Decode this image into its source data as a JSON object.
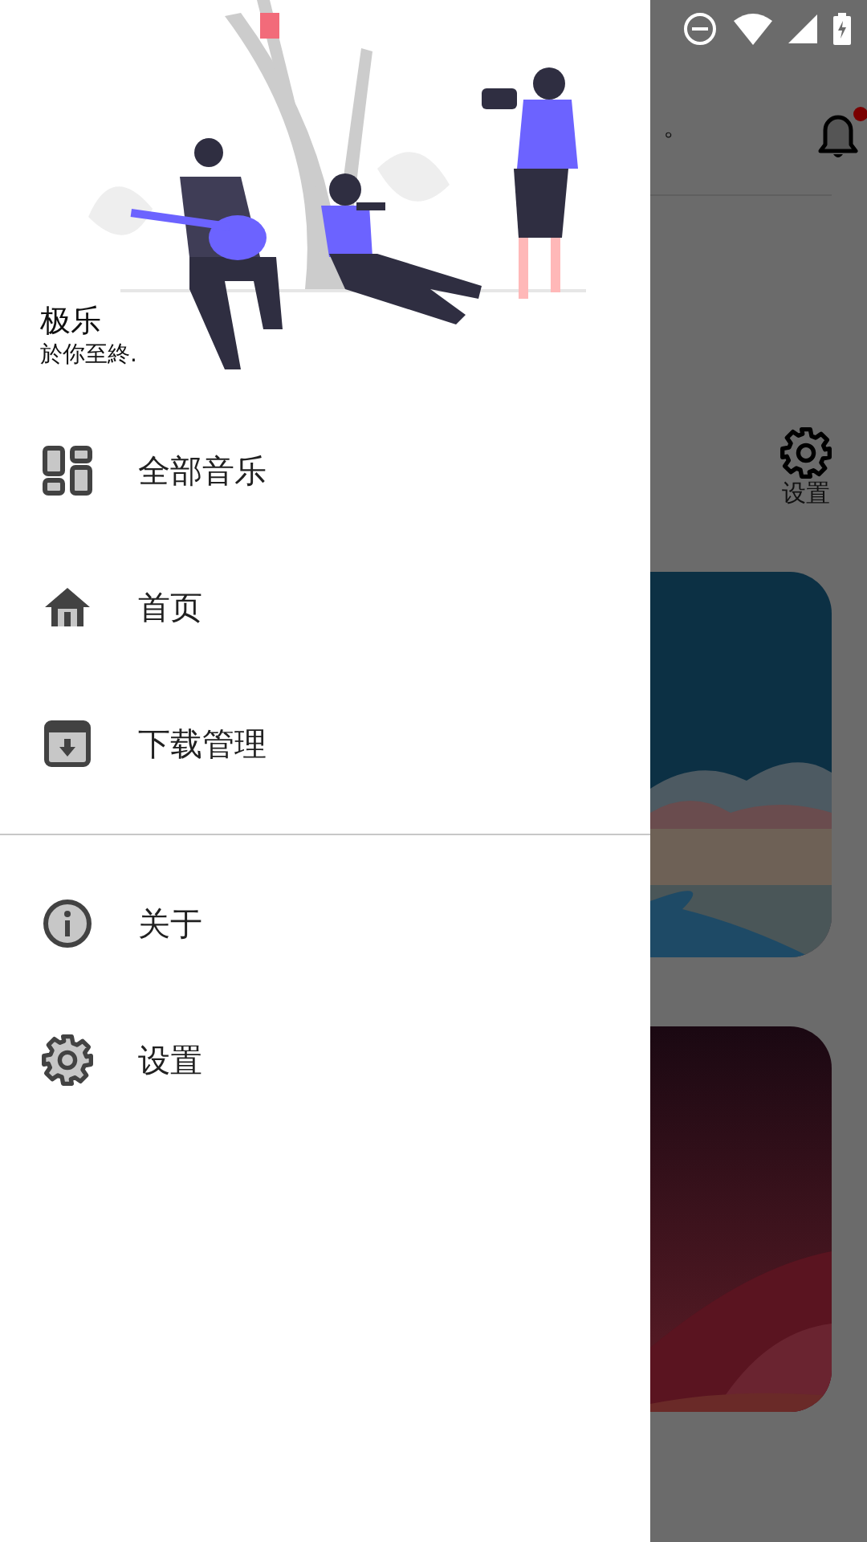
{
  "background": {
    "header_fragment": "。",
    "settings_label": "设置"
  },
  "drawer": {
    "title": "极乐",
    "subtitle": "於你至終.",
    "menu_groups": [
      [
        {
          "label": "全部音乐"
        },
        {
          "label": "首页"
        },
        {
          "label": "下载管理"
        }
      ],
      [
        {
          "label": "关于"
        },
        {
          "label": "设置"
        }
      ]
    ]
  }
}
